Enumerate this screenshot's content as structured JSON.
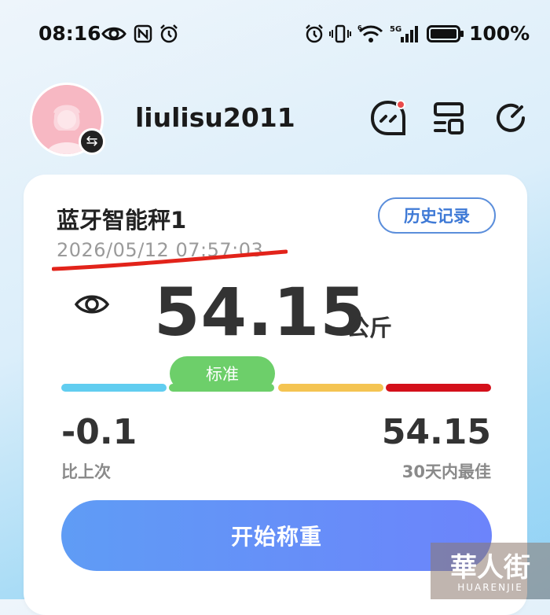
{
  "status_bar": {
    "time": "08:16",
    "icons_left": [
      "eye-icon",
      "nfc-icon",
      "alarm-icon"
    ],
    "icons_right": [
      "alarm-icon",
      "vibrate-icon",
      "wifi-icon",
      "signal-5g-icon",
      "battery-icon"
    ],
    "battery_level": 100,
    "battery_text": "100%"
  },
  "header": {
    "username": "liulisu2011",
    "switch_icon_glyph": "⇆",
    "icons": [
      "message-icon",
      "card-list-icon",
      "refresh-icon"
    ],
    "notification_dot_color": "#e94b4b"
  },
  "card": {
    "device_name": "蓝牙智能秤1",
    "history_label": "历史记录",
    "timestamp": "2026/05/12 07:57:03",
    "weight": "54.15",
    "unit": "公斤",
    "status_label": "标准",
    "status_segment_index": 2,
    "segment_colors": [
      "#61cdf0",
      "#6dcf6a",
      "#f4c452",
      "#d4101a"
    ],
    "diff_value": "-0.1",
    "diff_label": "比上次",
    "best_value": "54.15",
    "best_label": "30天内最佳",
    "start_label": "开始称重"
  },
  "watermark": {
    "text": "華人街",
    "sub": "HUARENJIE"
  },
  "colors": {
    "accent": "#3f7ad6",
    "button_gradient_start": "#5f9cf5",
    "button_gradient_end": "#6c84fb",
    "annotation_red": "#e2231a"
  }
}
